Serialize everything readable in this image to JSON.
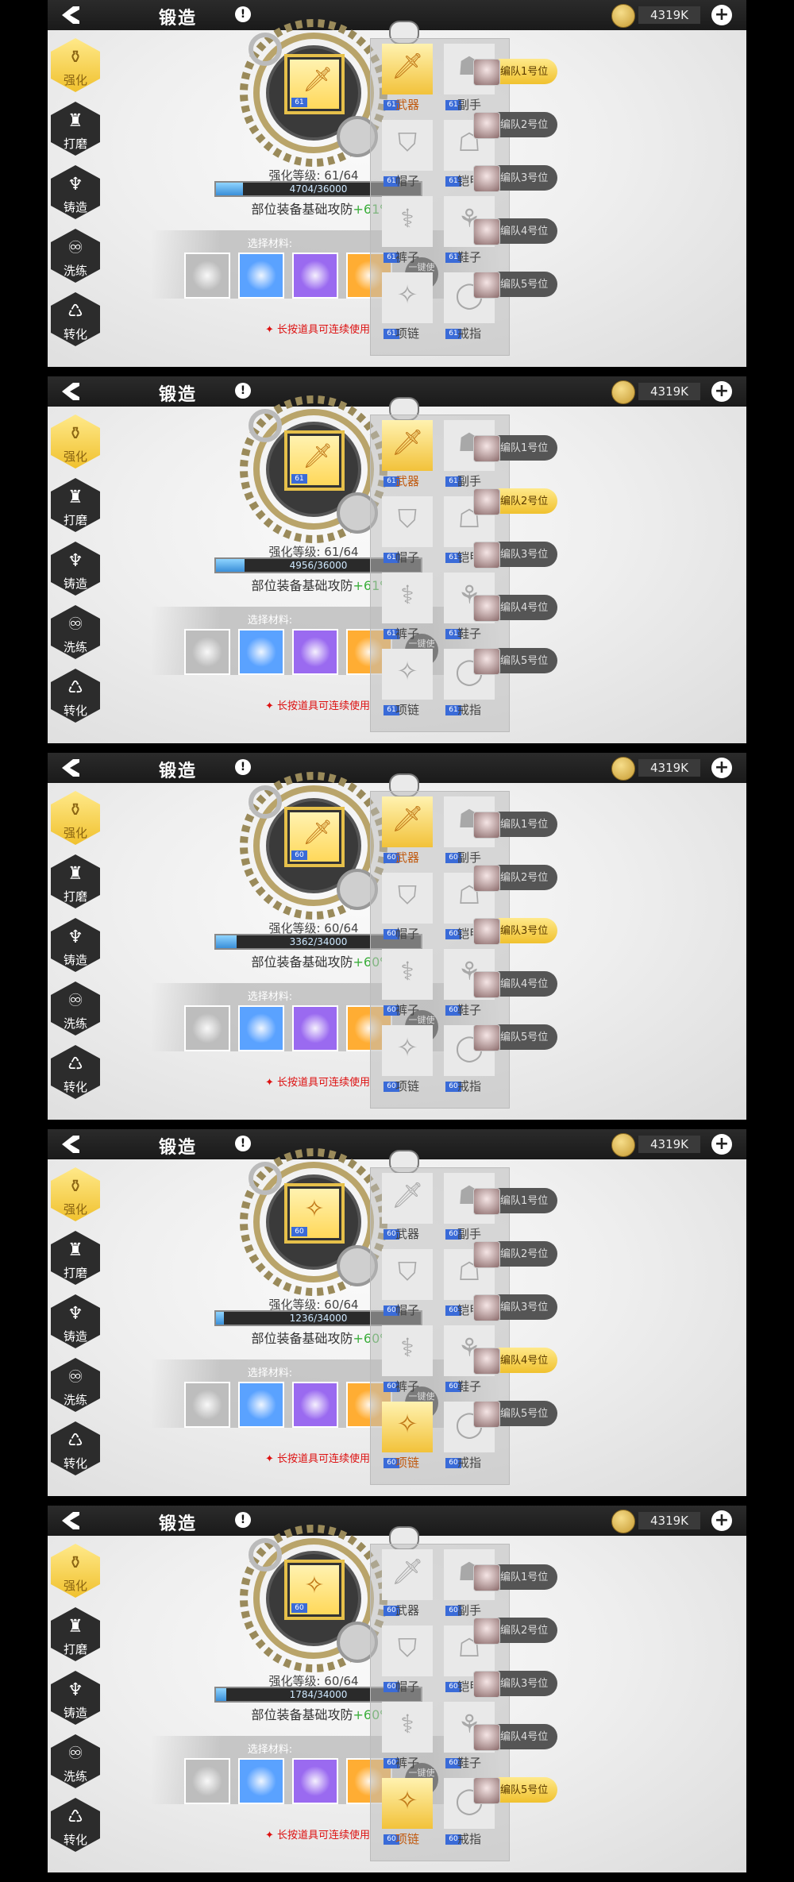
{
  "colors": {
    "accent": "#f0c12e",
    "bonus_green": "#3cae3c",
    "hint_red": "#d11111",
    "level_badge": "#3a6bd8"
  },
  "common": {
    "title": "锻造",
    "info": "!",
    "currency": "4319K",
    "plus": "+",
    "tabs": [
      "强化",
      "打磨",
      "铸造",
      "洗练",
      "转化"
    ],
    "level_prefix": "强化等级:",
    "bonus_label": "部位装备基础攻防",
    "material_title": "选择材料:",
    "use_button": "一键使用",
    "hint": "✦ 长按道具可连续使用",
    "slots": [
      "武器",
      "副手",
      "帽子",
      "铠甲",
      "裤子",
      "鞋子",
      "项链",
      "戒指"
    ],
    "teams": [
      "编队1号位",
      "编队2号位",
      "编队3号位",
      "编队4号位",
      "编队5号位"
    ]
  },
  "panels": [
    {
      "level": "61/64",
      "exp": "4704/36000",
      "exp_fraction": 0.13,
      "bonus": "+61%",
      "active_slot": 0,
      "active_team": 0,
      "center_icon": "weapon-icon",
      "center_lv": "61",
      "slot_lv": [
        "61",
        "61",
        "61",
        "61",
        "61",
        "61",
        "61",
        "61"
      ]
    },
    {
      "level": "61/64",
      "exp": "4956/36000",
      "exp_fraction": 0.14,
      "bonus": "+61%",
      "active_slot": 0,
      "active_team": 1,
      "center_icon": "weapon-icon",
      "center_lv": "61",
      "slot_lv": [
        "61",
        "61",
        "61",
        "61",
        "61",
        "61",
        "61",
        "61"
      ]
    },
    {
      "level": "60/64",
      "exp": "3362/34000",
      "exp_fraction": 0.1,
      "bonus": "+60%",
      "active_slot": 0,
      "active_team": 2,
      "center_icon": "weapon-icon",
      "center_lv": "60",
      "slot_lv": [
        "60",
        "60",
        "60",
        "60",
        "60",
        "60",
        "60",
        "60"
      ]
    },
    {
      "level": "60/64",
      "exp": "1236/34000",
      "exp_fraction": 0.04,
      "bonus": "+60%",
      "active_slot": 6,
      "active_team": 3,
      "center_icon": "necklace-icon",
      "center_lv": "60",
      "slot_lv": [
        "60",
        "60",
        "60",
        "60",
        "60",
        "60",
        "60",
        "60"
      ]
    },
    {
      "level": "60/64",
      "exp": "1784/34000",
      "exp_fraction": 0.05,
      "bonus": "+60%",
      "active_slot": 6,
      "active_team": 4,
      "center_icon": "necklace-icon",
      "center_lv": "60",
      "slot_lv": [
        "60",
        "60",
        "60",
        "60",
        "60",
        "60",
        "60",
        "60"
      ]
    }
  ]
}
